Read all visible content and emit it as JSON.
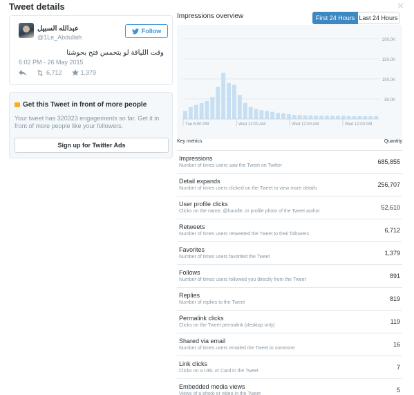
{
  "header": {
    "title": "Tweet details"
  },
  "tweet": {
    "display_name": "عبدالله السبيل",
    "screen_name": "@1Le_Abdullah",
    "follow_label": "Follow",
    "text": "وقت اللياقة لو يتحمس فتح بحوشنا",
    "time": "6:02 PM - 26 May 2015",
    "retweets": "6,712",
    "favorites": "1,379"
  },
  "promo": {
    "title": "Get this Tweet in front of more people",
    "body": "Your tweet has 320323 engagements so far. Get it in front of more people like your followers.",
    "button_label": "Sign up for Twitter Ads"
  },
  "overview": {
    "title": "Impressions overview",
    "tabs": [
      "First 24 Hours",
      "Last 24 Hours"
    ],
    "active_tab": "First 24 Hours"
  },
  "chart_data": {
    "type": "bar",
    "x_tick_labels": [
      "Tue 6:00 PM",
      "Wed 12:00 AM",
      "Wed 12:00 AM",
      "Wed 12:00 AM"
    ],
    "y_tick_labels": [
      "200.0K",
      "150.0K",
      "100.0K",
      "50.0K"
    ],
    "ylim": [
      0,
      200000
    ],
    "values": [
      20000,
      30000,
      35000,
      40000,
      45000,
      55000,
      80000,
      115000,
      90000,
      85000,
      60000,
      40000,
      30000,
      25000,
      22000,
      20000,
      18000,
      15000,
      14000,
      12000,
      10000,
      10000,
      9000,
      9000,
      8000,
      8000,
      8000,
      8000,
      8000,
      8000,
      7000,
      7000,
      7000,
      7000,
      7000,
      7000
    ],
    "bar_color": "#c6dff3",
    "grid": true
  },
  "metrics": {
    "header_label": "Key metrics",
    "quantity_label": "Quantity",
    "rows": [
      {
        "name": "Impressions",
        "desc": "Number of times users saw the Tweet on Twitter",
        "value": "685,855"
      },
      {
        "name": "Detail expands",
        "desc": "Number of times users clicked on the Tweet to view more details",
        "value": "256,707"
      },
      {
        "name": "User profile clicks",
        "desc": "Clicks on the name, @handle, or profile photo of the Tweet author",
        "value": "52,610"
      },
      {
        "name": "Retweets",
        "desc": "Number of times users retweeted the Tweet to their followers",
        "value": "6,712"
      },
      {
        "name": "Favorites",
        "desc": "Number of times users favorited the Tweet",
        "value": "1,379"
      },
      {
        "name": "Follows",
        "desc": "Number of times users followed you directly from the Tweet",
        "value": "891"
      },
      {
        "name": "Replies",
        "desc": "Number of replies to the Tweet",
        "value": "819"
      },
      {
        "name": "Permalink clicks",
        "desc": "Clicks on the Tweet permalink (desktop only)",
        "value": "119"
      },
      {
        "name": "Shared via email",
        "desc": "Number of times users emailed the Tweet to someone",
        "value": "16"
      },
      {
        "name": "Link clicks",
        "desc": "Clicks on a URL or Card in the Tweet",
        "value": "7"
      },
      {
        "name": "Embedded media views",
        "desc": "Views of a photo or video in the Tweet",
        "value": "5"
      }
    ]
  },
  "colors": {
    "accent": "#3b88c3",
    "text": "#292f33",
    "muted": "#8899a6",
    "border": "#e1e8ed"
  }
}
